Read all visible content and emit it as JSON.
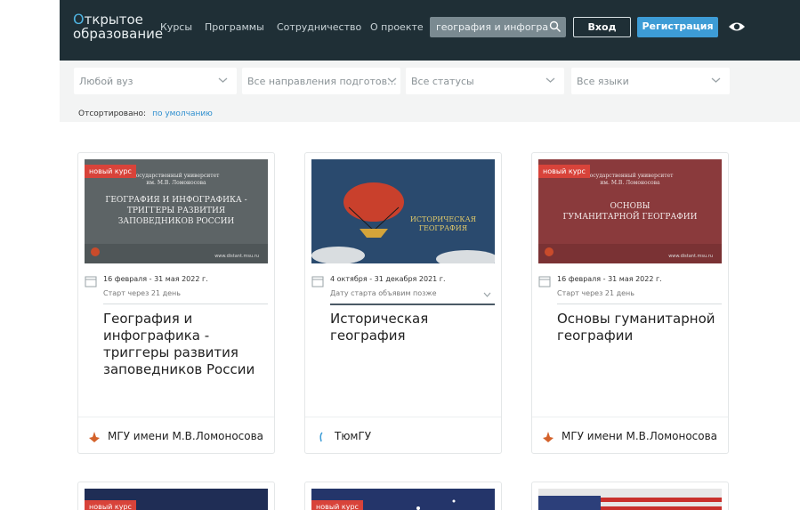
{
  "header": {
    "logo_line1": "ткрытое",
    "logo_o": "О",
    "logo_line2": "образование",
    "nav": [
      "Курсы",
      "Программы",
      "Сотрудничество",
      "О проекте"
    ],
    "search_value": "география и инфогра",
    "login_label": "Вход",
    "register_label": "Регистрация"
  },
  "filters": {
    "university": "Любой вуз",
    "direction": "Все направления подготов...",
    "status": "Все статусы",
    "language": "Все языки",
    "sorted_label": "Отсортировано:",
    "sorted_value": "по умолчанию"
  },
  "cards": [
    {
      "badge": "новый курс",
      "thumb_text": "ГЕОГРАФИЯ И ИНФОГРАФИКА - ТРИГГЕРЫ РАЗВИТИЯ ЗАПОВЕДНИКОВ РОССИИ",
      "date": "16 февраля - 31 мая 2022 г.",
      "start": "Старт через 21 день",
      "title": "География и инфографика - триггеры развития заповедников России",
      "university": "МГУ имени М.В.Ломоносова"
    },
    {
      "badge": "",
      "thumb_text": "ИСТОРИЧЕСКАЯ ГЕОГРАФИЯ",
      "date": "4 октября - 31 декабря 2021 г.",
      "start": "Дату старта объявим позже",
      "title": "Историческая география",
      "university": "ТюмГУ"
    },
    {
      "badge": "новый курс",
      "thumb_text": "ОСНОВЫ ГУМАНИТАРНОЙ ГЕОГРАФИИ",
      "date": "16 февраля - 31 мая 2022 г.",
      "start": "Старт через 21 день",
      "title": "Основы гуманитарной географии",
      "university": "МГУ имени М.В.Ломоносова"
    }
  ],
  "row2_badges": [
    "новый курс",
    "новый курс"
  ],
  "colors": {
    "header_bg": "#1f2f36",
    "accent": "#3d9cd6",
    "badge": "#d8433a"
  }
}
